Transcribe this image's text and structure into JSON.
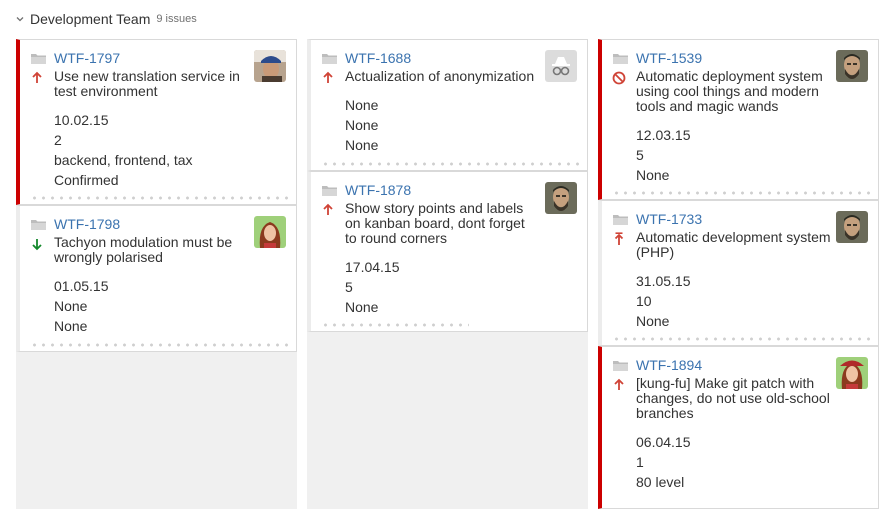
{
  "swimlane": {
    "title": "Development Team",
    "count": "9 issues"
  },
  "columns": [
    {
      "cards": [
        {
          "key": "WTF-1797",
          "summary": "Use new translation service in test environment",
          "priority": "arrow-up-icon",
          "avatar": "user-cap-avatar",
          "fields": [
            "10.02.15",
            "2",
            "backend, frontend, tax",
            "Confirmed"
          ]
        },
        {
          "key": "WTF-1798",
          "summary": "Tachyon modulation must be wrongly polarised",
          "priority": "arrow-down-icon",
          "avatar": "user-redhead-avatar",
          "fields": [
            "01.05.15",
            "None",
            "None"
          ]
        }
      ]
    },
    {
      "cards": [
        {
          "key": "WTF-1688",
          "summary": "Actualization of anonymization",
          "priority": "arrow-up-icon",
          "avatar": "anonymous-avatar",
          "fields": [
            "None",
            "None",
            "None"
          ]
        },
        {
          "key": "WTF-1878",
          "summary": "Show story points and labels on kanban board, dont forget to round corners",
          "priority": "arrow-up-icon",
          "avatar": "user-bearded-avatar",
          "fields": [
            "17.04.15",
            "5",
            "None"
          ]
        }
      ]
    },
    {
      "cards": [
        {
          "key": "WTF-1539",
          "summary": "Automatic deployment system using cool things and modern tools and magic wands",
          "priority": "blocker-icon",
          "avatar": "user-bearded-avatar",
          "fields": [
            "12.03.15",
            "5",
            "None"
          ]
        },
        {
          "key": "WTF-1733",
          "summary": "Automatic development system (PHP)",
          "priority": "critical-icon",
          "avatar": "user-bearded-avatar",
          "fields": [
            "31.05.15",
            "10",
            "None"
          ]
        },
        {
          "key": "WTF-1894",
          "summary": "[kung-fu] Make git patch with changes, do not use old-school branches",
          "priority": "arrow-up-icon",
          "avatar": "user-redhead-avatar",
          "fields": [
            "06.04.15",
            "1",
            "80 level"
          ]
        }
      ]
    }
  ],
  "colors": {
    "link": "#3b73af",
    "flag": "#cc0000",
    "column_bg": "#f0f0f0"
  }
}
